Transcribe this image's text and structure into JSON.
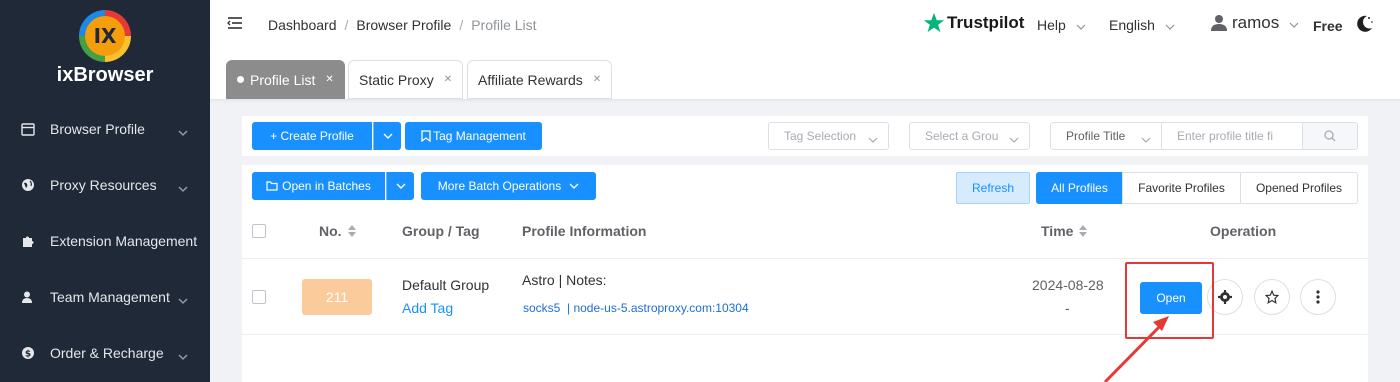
{
  "brand": {
    "name": "ixBrowser",
    "logo_text": "IX"
  },
  "sidebar": {
    "items": [
      {
        "label": "Browser Profile",
        "icon": "calendar-icon",
        "has_chevron": true
      },
      {
        "label": "Proxy Resources",
        "icon": "globe-icon",
        "has_chevron": true
      },
      {
        "label": "Extension Management",
        "icon": "puzzle-icon",
        "has_chevron": false
      },
      {
        "label": "Team Management",
        "icon": "user-group-icon",
        "has_chevron": true
      },
      {
        "label": "Order & Recharge",
        "icon": "dollar-icon",
        "has_chevron": true
      }
    ]
  },
  "header": {
    "breadcrumb": [
      "Dashboard",
      "Browser Profile",
      "Profile List"
    ],
    "trustpilot": "Trustpilot",
    "help": "Help",
    "language": "English",
    "user": "ramos",
    "plan": "Free"
  },
  "tabs": [
    {
      "label": "Profile List",
      "active": true
    },
    {
      "label": "Static Proxy",
      "active": false
    },
    {
      "label": "Affiliate Rewards",
      "active": false
    }
  ],
  "toolbar": {
    "create_profile": "+ Create Profile",
    "tag_management": "Tag Management",
    "tag_selection_placeholder": "Tag Selection",
    "group_placeholder": "Select a Grou",
    "search_field": "Profile Title",
    "search_placeholder": "Enter profile title fi",
    "open_in_batches": "Open in Batches",
    "more_batch": "More Batch Operations",
    "refresh": "Refresh",
    "filters": [
      "All Profiles",
      "Favorite Profiles",
      "Opened Profiles"
    ]
  },
  "table": {
    "headers": {
      "no": "No.",
      "group": "Group / Tag",
      "info": "Profile Information",
      "time": "Time",
      "operation": "Operation"
    },
    "rows": [
      {
        "no": "211",
        "group": "Default Group",
        "add_tag": "Add Tag",
        "info": "Astro | Notes:",
        "proxy_type": "socks5",
        "proxy_host": "| node-us-5.astroproxy.com:10304",
        "time": "2024-08-28",
        "time2": "-",
        "open_label": "Open"
      }
    ]
  },
  "colors": {
    "primary": "#1890ff",
    "sidebar": "#1f2937",
    "highlight": "#e53935",
    "number_badge": "#fbcb9b"
  }
}
